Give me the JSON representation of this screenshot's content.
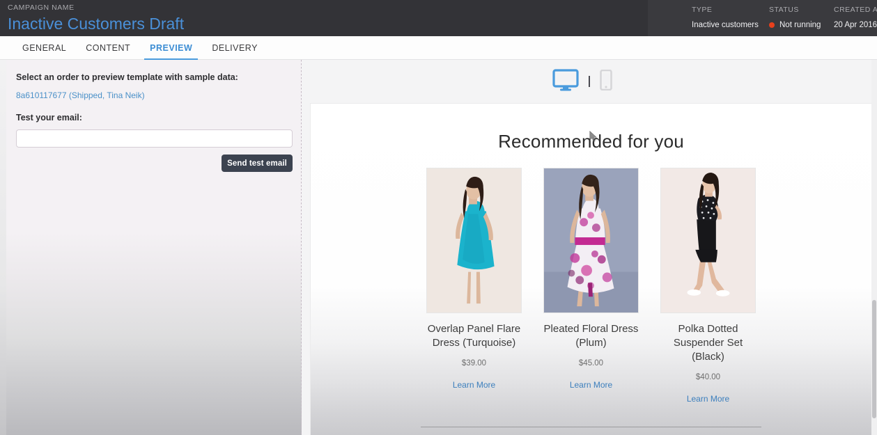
{
  "header": {
    "campaign_label": "CAMPAIGN NAME",
    "campaign_title": "Inactive Customers Draft",
    "meta": {
      "type_label": "TYPE",
      "type_value": "Inactive customers",
      "status_label": "STATUS",
      "status_value": "Not running",
      "status_color": "#e8401c",
      "created_label": "CREATED AT",
      "created_value": "20 Apr 2016"
    },
    "title_color": "#4a90d9"
  },
  "tabs": [
    {
      "label": "GENERAL",
      "active": false
    },
    {
      "label": "CONTENT",
      "active": false
    },
    {
      "label": "PREVIEW",
      "active": true
    },
    {
      "label": "DELIVERY",
      "active": false
    }
  ],
  "left_panel": {
    "select_order_heading": "Select an order to preview template with sample data:",
    "order_link": "8a610117677 (Shipped, Tina Neik)",
    "test_email_heading": "Test your email:",
    "email_input_value": "",
    "email_input_placeholder": "",
    "send_button_label": "Send test email"
  },
  "preview": {
    "device_desktop_name": "desktop-view-icon",
    "device_mobile_name": "mobile-view-icon",
    "active_device": "desktop",
    "desktop_icon_color": "#4a9bdd",
    "mobile_icon_color": "#d3d3d6",
    "email": {
      "title": "Recommended for you",
      "products": [
        {
          "name": "Overlap Panel Flare Dress (Turquoise)",
          "price": "$39.00",
          "link_label": "Learn More",
          "image_alt": "turquoise-flare-dress"
        },
        {
          "name": "Pleated Floral Dress (Plum)",
          "price": "$45.00",
          "link_label": "Learn More",
          "image_alt": "plum-floral-dress"
        },
        {
          "name": "Polka Dotted Suspender Set (Black)",
          "price": "$40.00",
          "link_label": "Learn More",
          "image_alt": "black-polka-suspender-set"
        }
      ]
    }
  }
}
